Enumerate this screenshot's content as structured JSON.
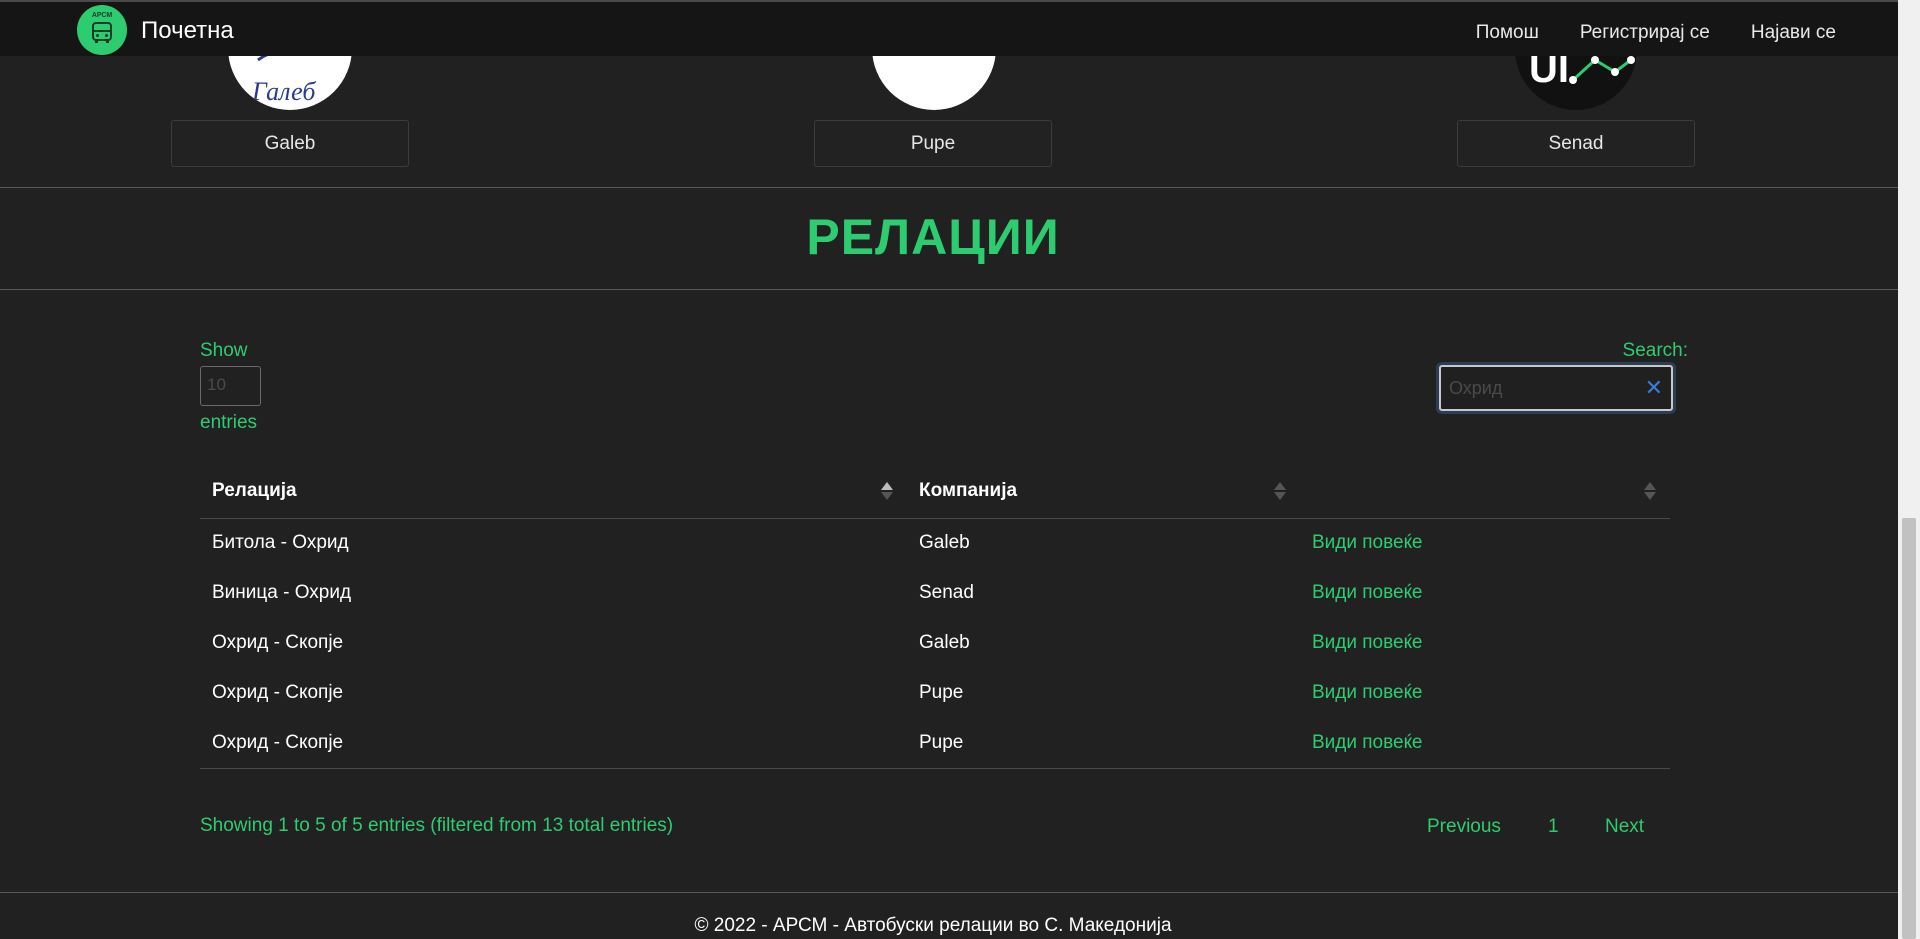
{
  "navbar": {
    "logo_text": "АРСМ",
    "title": "Почетна",
    "links": [
      "Помош",
      "Регистрирај се",
      "Најави се"
    ]
  },
  "companies": [
    {
      "name": "Galeb",
      "logo_text": "Галеб"
    },
    {
      "name": "Pupe"
    },
    {
      "name": "Senad",
      "logo_text": "UI"
    }
  ],
  "section": {
    "title": "РЕЛАЦИИ"
  },
  "length_control": {
    "show_label": "Show",
    "value": "10",
    "entries_label": "entries"
  },
  "search": {
    "label": "Search:",
    "value": "Охрид"
  },
  "table": {
    "columns": [
      "Релација",
      "Компанија",
      ""
    ],
    "rows": [
      {
        "route": "Битола - Охрид",
        "company": "Galeb",
        "action": "Види повеќе"
      },
      {
        "route": "Виница - Охрид",
        "company": "Senad",
        "action": "Види повеќе"
      },
      {
        "route": "Охрид - Скопје",
        "company": "Galeb",
        "action": "Види повеќе"
      },
      {
        "route": "Охрид - Скопје",
        "company": "Pupe",
        "action": "Види повеќе"
      },
      {
        "route": "Охрид - Скопје",
        "company": "Pupe",
        "action": "Види повеќе"
      }
    ]
  },
  "info": "Showing 1 to 5 of 5 entries (filtered from 13 total entries)",
  "pagination": {
    "previous": "Previous",
    "page": "1",
    "next": "Next"
  },
  "footer": "© 2022 - АРСМ - Автобуски релации во С. Македонија",
  "colors": {
    "accent": "#2ecc71",
    "background": "#212121",
    "navbar": "#151515"
  }
}
